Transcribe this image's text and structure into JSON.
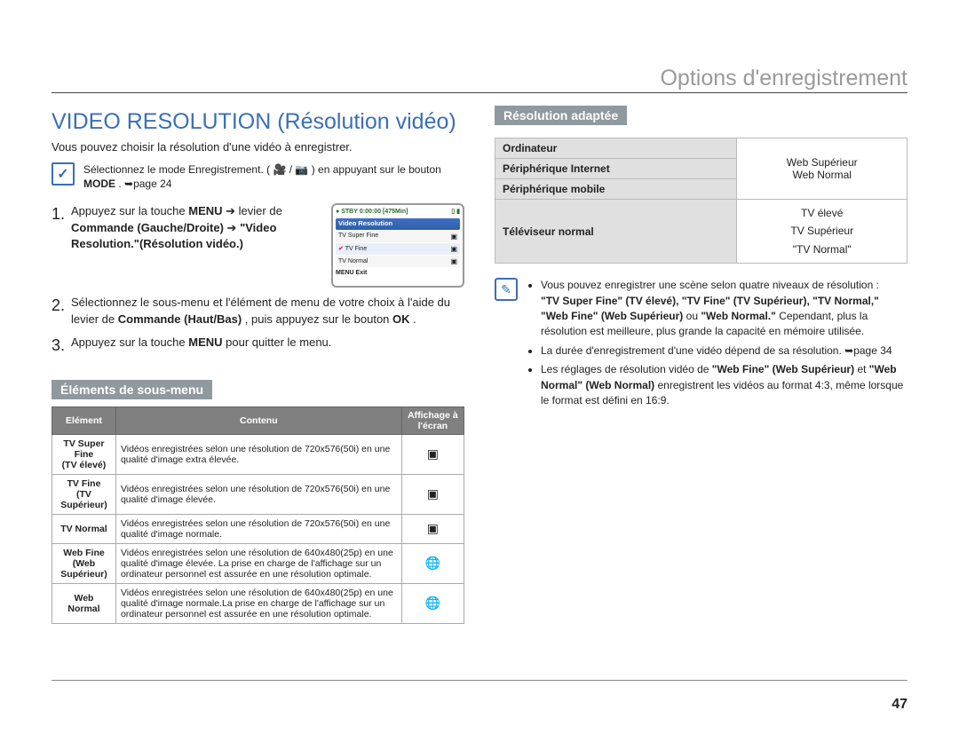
{
  "breadcrumb": "Options d'enregistrement",
  "title": "VIDEO RESOLUTION (Résolution vidéo)",
  "intro": "Vous pouvez choisir la résolution d'une vidéo à enregistrer.",
  "tip_prefix": "Sélectionnez le mode Enregistrement. (",
  "tip_mid": " / ",
  "tip_suffix": ") en appuyant sur le bouton ",
  "tip_mode": "MODE",
  "tip_page": ". ➥page 24",
  "steps": {
    "s1a": "Appuyez sur la touche ",
    "s1_menu": "MENU",
    "s1b": " ➔ levier de ",
    "s1_lever": "Commande (Gauche/Droite)",
    "s1c": " ➔ ",
    "s1_path": "\"Video Resolution.\"(Résolution vidéo.)",
    "s2a": "Sélectionnez le sous-menu et l'élément de menu de votre choix à l'aide du levier de ",
    "s2_cmd": "Commande (Haut/Bas)",
    "s2b": ", puis appuyez sur le bouton ",
    "s2_ok": "OK",
    "s2c": ".",
    "s3a": "Appuyez sur la touche ",
    "s3_menu": "MENU",
    "s3b": " pour quitter le menu."
  },
  "lcd": {
    "stby": "STBY",
    "time": "0:00:00",
    "remain": "[475Min]",
    "head": "Video Resolution",
    "items": [
      "TV Super Fine",
      "TV Fine",
      "TV Normal"
    ],
    "exit": "MENU Exit"
  },
  "subhead1": "Éléments de sous-menu",
  "table1": {
    "h1": "Elément",
    "h2": "Contenu",
    "h3": "Affichage à l'écran",
    "rows": [
      {
        "name": "TV Super Fine\n(TV élevé)",
        "desc": "Vidéos enregistrées selon une résolution de 720x576(50i) en une qualité d'image extra élevée.",
        "icon": "▣"
      },
      {
        "name": "TV Fine\n(TV Supérieur)",
        "desc": "Vidéos enregistrées selon une résolution de 720x576(50i) en une qualité d'image élevée.",
        "icon": "▣"
      },
      {
        "name": "TV Normal",
        "desc": "Vidéos enregistrées selon une résolution de 720x576(50i) en une qualité d'image normale.",
        "icon": "▣"
      },
      {
        "name": "Web Fine\n(Web Supérieur)",
        "desc": "Vidéos enregistrées selon une résolution de 640x480(25p) en une qualité d'image élevée. La prise en charge de l'affichage sur un ordinateur personnel est assurée en une résolution optimale.",
        "icon": "🌐"
      },
      {
        "name": "Web Normal",
        "desc": "Vidéos enregistrées selon une résolution de 640x480(25p) en une qualité d'image normale.La prise en charge de l'affichage sur un ordinateur personnel est assurée en une résolution optimale.",
        "icon": "🌐"
      }
    ]
  },
  "subhead2": "Résolution adaptée",
  "table2": {
    "rows": [
      {
        "k": "Ordinateur",
        "v1": "Web Supérieur",
        "v2": ""
      },
      {
        "k": "Périphérique Internet",
        "v1": "Web Normal",
        "v2": ""
      },
      {
        "k": "Périphérique mobile",
        "v1": "",
        "v2": ""
      },
      {
        "k": "Téléviseur normal",
        "v1": "TV élevé",
        "v2": "TV Supérieur",
        "v3": "\"TV Normal\""
      }
    ]
  },
  "tips2": {
    "lead": "Vous pouvez enregistrer une scène selon quatre niveaux de résolution :",
    "line2": "\"TV Super Fine\" (TV élevé), \"TV Fine\" (TV Supérieur), \"TV Normal,\" \"Web Fine\" (Web Supérieur)",
    "line2b": " ou ",
    "line2c": "\"Web Normal.\"",
    "line2d": " Cependant, plus la résolution est meilleure, plus grande la capacité en mémoire utilisée.",
    "b2": "La durée d'enregistrement d'une vidéo dépend de sa résolution. ➥page 34",
    "b3a": "Les réglages de résolution vidéo de ",
    "b3b": "\"Web Fine\" (Web Supérieur)",
    "b3c": " et ",
    "b3d": "\"Web Normal\" (Web Normal)",
    "b3e": " enregistrent les vidéos au format 4:3, même lorsque le format est défini en 16:9."
  },
  "pagenum": "47"
}
